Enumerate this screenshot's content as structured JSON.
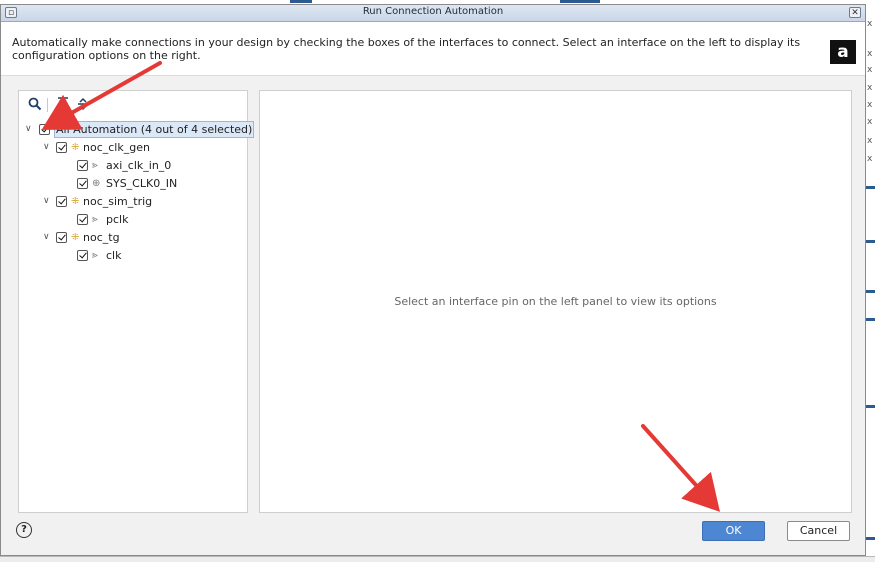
{
  "window": {
    "title": "Run Connection Automation",
    "menu_icon": "window-menu-icon",
    "close_icon": "close-icon"
  },
  "description": "Automatically make connections in your design by checking the boxes of the interfaces to connect. Select an interface on the left to display its configuration options on the right.",
  "logo": {
    "icon": "amd-logo-icon",
    "glyph": "a"
  },
  "toolbar": {
    "search_icon": "search-icon",
    "collapse_icon": "collapse-all-icon",
    "expand_icon": "expand-all-icon"
  },
  "tree": {
    "root": {
      "label": "All Automation (4 out of 4 selected)",
      "checked": true,
      "expanded": true
    },
    "nodes": [
      {
        "label": "noc_clk_gen",
        "checked": true,
        "expanded": true,
        "children": [
          {
            "label": "axi_clk_in_0",
            "checked": true,
            "icon": "clock-pin-icon"
          },
          {
            "label": "SYS_CLK0_IN",
            "checked": true,
            "icon": "diff-clock-pin-icon"
          }
        ]
      },
      {
        "label": "noc_sim_trig",
        "checked": true,
        "expanded": true,
        "children": [
          {
            "label": "pclk",
            "checked": true,
            "icon": "clock-pin-icon"
          }
        ]
      },
      {
        "label": "noc_tg",
        "checked": true,
        "expanded": true,
        "children": [
          {
            "label": "clk",
            "checked": true,
            "icon": "clock-pin-icon"
          }
        ]
      }
    ]
  },
  "right_panel": {
    "hint": "Select an interface pin on the left panel to view its options"
  },
  "footer": {
    "help_label": "?",
    "ok_label": "OK",
    "cancel_label": "Cancel"
  },
  "colors": {
    "accent": "#4d86d3",
    "annotation_arrow": "#e53935",
    "selection": "#dbe8f7"
  }
}
